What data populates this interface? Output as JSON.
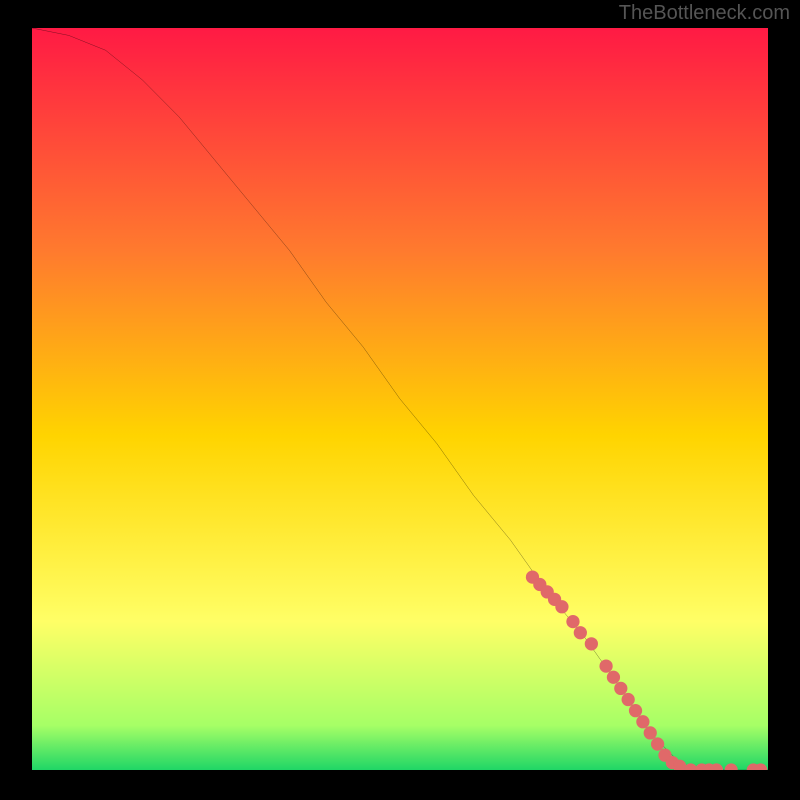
{
  "watermark": "TheBottleneck.com",
  "colors": {
    "background": "#000000",
    "curve": "#000000",
    "marker": "#e06969",
    "grad_top": "#ff1a44",
    "grad_q1": "#ff7a2e",
    "grad_mid": "#ffd400",
    "grad_q3": "#ffff66",
    "grad_near_bottom": "#a6ff66",
    "grad_bottom": "#1fd666"
  },
  "chart_data": {
    "type": "line",
    "title": "",
    "xlabel": "",
    "ylabel": "",
    "xlim": [
      0,
      100
    ],
    "ylim": [
      0,
      100
    ],
    "series": [
      {
        "name": "curve",
        "x": [
          0,
          5,
          10,
          15,
          20,
          25,
          30,
          35,
          40,
          45,
          50,
          55,
          60,
          65,
          70,
          75,
          80,
          82,
          84,
          86,
          88,
          90,
          92,
          94,
          96,
          98,
          100
        ],
        "y": [
          100,
          99,
          97,
          93,
          88,
          82,
          76,
          70,
          63,
          57,
          50,
          44,
          37,
          31,
          24,
          18,
          11,
          8,
          5,
          3,
          1,
          0,
          0,
          0,
          0,
          0,
          0
        ]
      }
    ],
    "markers_along_curve": [
      {
        "x": 68.0,
        "y": 26
      },
      {
        "x": 69.0,
        "y": 25
      },
      {
        "x": 70.0,
        "y": 24
      },
      {
        "x": 71.0,
        "y": 23
      },
      {
        "x": 72.0,
        "y": 22
      },
      {
        "x": 73.5,
        "y": 20
      },
      {
        "x": 74.5,
        "y": 18.5
      },
      {
        "x": 76.0,
        "y": 17
      },
      {
        "x": 78.0,
        "y": 14
      },
      {
        "x": 79.0,
        "y": 12.5
      },
      {
        "x": 80.0,
        "y": 11
      },
      {
        "x": 81.0,
        "y": 9.5
      },
      {
        "x": 82.0,
        "y": 8
      },
      {
        "x": 83.0,
        "y": 6.5
      },
      {
        "x": 84.0,
        "y": 5
      },
      {
        "x": 85.0,
        "y": 3.5
      },
      {
        "x": 86.0,
        "y": 2
      },
      {
        "x": 87.0,
        "y": 1
      },
      {
        "x": 88.0,
        "y": 0.5
      },
      {
        "x": 89.5,
        "y": 0
      },
      {
        "x": 91.0,
        "y": 0
      },
      {
        "x": 92.0,
        "y": 0
      },
      {
        "x": 93.0,
        "y": 0
      },
      {
        "x": 95.0,
        "y": 0
      },
      {
        "x": 98.0,
        "y": 0
      },
      {
        "x": 99.0,
        "y": 0
      }
    ]
  }
}
